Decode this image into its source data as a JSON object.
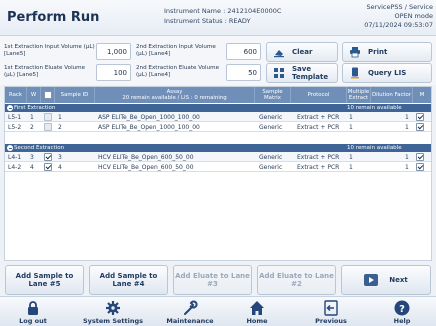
{
  "header": {
    "title": "Perform Run",
    "instrument_name": "Instrument Name : 2412104E0000C",
    "instrument_status": "Instrument Status : READY",
    "user": "ServicePSS / Service",
    "mode": "OPEN mode",
    "datetime": "07/11/2024 09:53:07"
  },
  "params": {
    "first_input_label": "1st Extraction Input Volume (µL) [Lane5]",
    "first_input_value": "1,000",
    "second_input_label": "2nd Extraction Input Volume (µL) [Lane4]",
    "second_input_value": "600",
    "first_eluate_label": "1st Extraction Eluate Volume (µL) [Lane5]",
    "first_eluate_value": "100",
    "second_eluate_label": "2nd Extraction Eluate Volume (µL) [Lane4]",
    "second_eluate_value": "50"
  },
  "toolbar": {
    "clear": "Clear",
    "print": "Print",
    "save_template": "Save Template",
    "query_lis": "Query LIS"
  },
  "table": {
    "columns": {
      "rack": "Rack",
      "w": "W",
      "sample_id": "Sample ID",
      "assay": "Assay",
      "assay_sub": "20 remain available / LIS : 0 remaining",
      "sample_matrix": "Sample Matrix",
      "protocol": "Protocol",
      "multiple_extract": "Multiple Extract",
      "dilution_factor": "Dilution Factor",
      "m": "M"
    },
    "sections": [
      {
        "name": "First Extraction",
        "info": "10 remain available",
        "rows": [
          {
            "rack": "L5-1",
            "w": "1",
            "checked": false,
            "sample_id": "1",
            "assay": "ASP ELITe_Be_Open_1000_100_00",
            "matrix": "Generic",
            "protocol": "Extract + PCR",
            "multiple": "1",
            "dilution": "1",
            "m": true
          },
          {
            "rack": "L5-2",
            "w": "2",
            "checked": false,
            "sample_id": "2",
            "assay": "ASP ELITe_Be_Open_1000_100_00",
            "matrix": "Generic",
            "protocol": "Extract + PCR",
            "multiple": "1",
            "dilution": "1",
            "m": true
          }
        ]
      },
      {
        "name": "Second Extraction",
        "info": "10 remain available",
        "rows": [
          {
            "rack": "L4-1",
            "w": "3",
            "checked": true,
            "sample_id": "3",
            "assay": "HCV ELITe_Be_Open_600_50_00",
            "matrix": "Generic",
            "protocol": "Extract + PCR",
            "multiple": "1",
            "dilution": "1",
            "m": true
          },
          {
            "rack": "L4-2",
            "w": "4",
            "checked": true,
            "sample_id": "4",
            "assay": "HCV ELITe_Be_Open_600_50_00",
            "matrix": "Generic",
            "protocol": "Extract + PCR",
            "multiple": "1",
            "dilution": "1",
            "m": true
          }
        ]
      }
    ]
  },
  "actions": {
    "add_sample_5": "Add Sample to Lane #5",
    "add_sample_4": "Add Sample to Lane #4",
    "add_eluate_3": "Add Eluate to Lane #3",
    "add_eluate_2": "Add Eluate to Lane #2",
    "next": "Next"
  },
  "nav": {
    "logout": "Log out",
    "system_settings": "System Settings",
    "maintenance": "Maintenance",
    "home": "Home",
    "previous": "Previous",
    "help": "Help"
  },
  "icons": [
    "lock-icon",
    "gear-icon",
    "wrench-icon",
    "home-icon",
    "previous-icon",
    "help-icon",
    "clear-icon",
    "print-icon",
    "save-template-icon",
    "query-lis-icon",
    "next-arrow-icon",
    "collapse-icon"
  ],
  "colors": {
    "header_blue": "#6f8fb8",
    "section_blue": "#3f6496",
    "nav_icon": "#24467a"
  }
}
